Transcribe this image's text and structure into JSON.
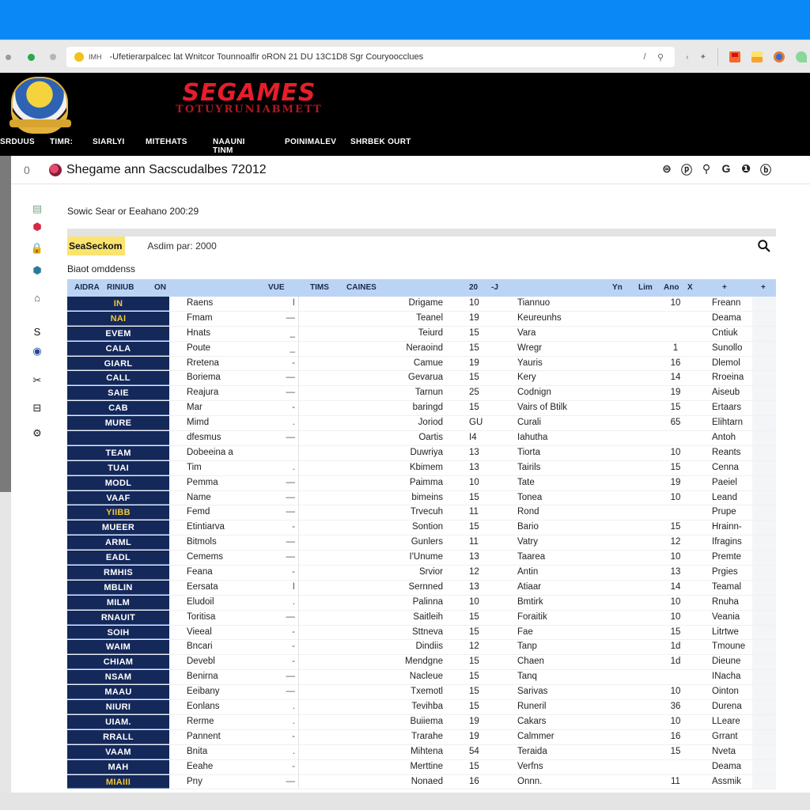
{
  "browser": {
    "tab_short": "IMH",
    "url": "-Ufetierarpalcec lat Wnitcor Tounnoalfir oRON 21 DU 13C1D8 Sgr Couryoocclues",
    "addr_icons": [
      "edit-icon",
      "bookmark-icon"
    ],
    "extensions": [
      "red-extension",
      "yellow-extension",
      "blue-extension",
      "green-extension"
    ]
  },
  "site": {
    "brand_title": "SEGAMES",
    "brand_subtitle": "TOTUYRUNIABMETT",
    "nav": [
      "SRDUUS",
      "TIMR:",
      "SIARLYI",
      "MITEHATS",
      "NAAUNI TINM",
      "POINIMALEV",
      "SHRBEK OURT"
    ]
  },
  "page": {
    "counter": "0",
    "title": "Shegame ann Sacscudalbes 72012",
    "top_icons": [
      "list-icon",
      "help-icon",
      "pin-icon",
      "g-icon",
      "user-icon",
      "badge-icon"
    ],
    "top_icon_glyphs": [
      "⊜",
      "ⓟ",
      "⚲",
      "G",
      "❶",
      "ⓑ"
    ],
    "season_line": "Sowic Sear or Eeahano 200:29",
    "tag": "SeaSeckom",
    "filter_text": "Asdim par: 2000",
    "section_title": "Biaot omddenss"
  },
  "sidebar": {
    "icons": [
      {
        "name": "doc-icon",
        "glyph": "▤",
        "color": "#7aa888"
      },
      {
        "name": "team-crest-red-icon",
        "glyph": "⬢",
        "color": "#d42a44"
      },
      {
        "name": "lock-badge-icon",
        "glyph": "🔒",
        "color": "#e7c21c"
      },
      {
        "name": "team-crest-blue-icon",
        "glyph": "⬢",
        "color": "#2a7a9a"
      },
      {
        "name": "home-icon",
        "glyph": "⌂",
        "color": "#444"
      },
      {
        "name": "s-icon",
        "glyph": "S",
        "color": "#111"
      },
      {
        "name": "bulb-icon",
        "glyph": "◉",
        "color": "#1f4a9a"
      },
      {
        "name": "tools-icon",
        "glyph": "✂",
        "color": "#222"
      },
      {
        "name": "printer-icon",
        "glyph": "⊟",
        "color": "#222"
      },
      {
        "name": "settings-icon",
        "glyph": "⚙",
        "color": "#222"
      }
    ]
  },
  "table": {
    "headers": [
      "AIDRA",
      "RINIUB",
      "ON",
      "VUE",
      "TIMS",
      "CAINES",
      "20",
      "-J",
      "Yn",
      "Lim",
      "Ano",
      "X",
      "+",
      "+"
    ],
    "rows": [
      {
        "code": "IN",
        "gold": true,
        "name": "Raens",
        "mark": "I",
        "team": "Drigame",
        "n1": "10",
        "opp": "Tiannuo",
        "n2": "10",
        "city": "Freann"
      },
      {
        "code": "NAI",
        "gold": true,
        "name": "Fmam",
        "mark": "—",
        "team": "Teanel",
        "n1": "19",
        "opp": "Keureunhs",
        "n2": "",
        "city": "Deama"
      },
      {
        "code": "EVEM",
        "gold": false,
        "name": "Hnats",
        "mark": "_",
        "team": "Teiurd",
        "n1": "15",
        "opp": "Vara",
        "n2": "",
        "city": "Cntiuk"
      },
      {
        "code": "CALA",
        "gold": false,
        "name": "Poute",
        "mark": "_",
        "team": "Neraoind",
        "n1": "15",
        "opp": "Wregr",
        "n2": "1",
        "city": "Sunollo"
      },
      {
        "code": "GIARL",
        "gold": false,
        "name": "Rretena",
        "mark": "-",
        "team": "Camue",
        "n1": "19",
        "opp": "Yauris",
        "n2": "16",
        "city": "Dlemol"
      },
      {
        "code": "CALL",
        "gold": false,
        "name": "Boriema",
        "mark": "—",
        "team": "Gevarua",
        "n1": "15",
        "opp": "Kery",
        "n2": "14",
        "city": "Rroeina"
      },
      {
        "code": "SAIE",
        "gold": false,
        "name": "Reajura",
        "mark": "—",
        "team": "Tarnun",
        "n1": "25",
        "opp": "Codnign",
        "n2": "19",
        "city": "Aiseub"
      },
      {
        "code": "CAB",
        "gold": false,
        "name": "Mar",
        "mark": "-",
        "team": "baringd",
        "n1": "15",
        "opp": "Vairs of Btilk",
        "n2": "15",
        "city": "Ertaars"
      },
      {
        "code": "MURE",
        "gold": false,
        "name": "Mimd",
        "mark": ".",
        "team": "Joriod",
        "n1": "GU",
        "opp": "Curali",
        "n2": "65",
        "city": "Elihtarn"
      },
      {
        "code": "",
        "gold": false,
        "name": "dfesmus",
        "mark": "—",
        "team": "Oartis",
        "n1": "I4",
        "opp": "Iahutha",
        "n2": "",
        "city": "Antoh"
      },
      {
        "code": "TEAM",
        "gold": false,
        "name": "Dobeeina a",
        "mark": "",
        "team": "Duwriya",
        "n1": "13",
        "opp": "Tiorta",
        "n2": "10",
        "city": "Reants"
      },
      {
        "code": "TUAI",
        "gold": false,
        "name": "Tim",
        "mark": ".",
        "team": "Kbimem",
        "n1": "13",
        "opp": "Tairils",
        "n2": "15",
        "city": "Cenna"
      },
      {
        "code": "MODL",
        "gold": false,
        "name": "Pemma",
        "mark": "—",
        "team": "Paimma",
        "n1": "10",
        "opp": "Tate",
        "n2": "19",
        "city": "Paeiel"
      },
      {
        "code": "VAAF",
        "gold": false,
        "name": "Name",
        "mark": "—",
        "team": "bimeins",
        "n1": "15",
        "opp": "Tonea",
        "n2": "10",
        "city": "Leand"
      },
      {
        "code": "YIIBB",
        "gold": true,
        "name": "Femd",
        "mark": "—",
        "team": "Trvecuh",
        "n1": "11",
        "opp": "Rond",
        "n2": "",
        "city": "Prupe"
      },
      {
        "code": "MUEER",
        "gold": false,
        "name": "Etintiarva",
        "mark": "-",
        "team": "Sontion",
        "n1": "15",
        "opp": "Bario",
        "n2": "15",
        "city": "Hrainn-"
      },
      {
        "code": "ARML",
        "gold": false,
        "name": "Bitmols",
        "mark": "—",
        "team": "Gunlers",
        "n1": "11",
        "opp": "Vatry",
        "n2": "12",
        "city": "Ifragins"
      },
      {
        "code": "EADL",
        "gold": false,
        "name": "Cemems",
        "mark": "—",
        "team": "I'Unume",
        "n1": "13",
        "opp": "Taarea",
        "n2": "10",
        "city": "Premte"
      },
      {
        "code": "RMHIS",
        "gold": false,
        "name": "Feana",
        "mark": "-",
        "team": "Srvior",
        "n1": "12",
        "opp": "Antin",
        "n2": "13",
        "city": "Prgies"
      },
      {
        "code": "MBLIN",
        "gold": false,
        "name": "Eersata",
        "mark": "I",
        "team": "Sernned",
        "n1": "13",
        "opp": "Atiaar",
        "n2": "14",
        "city": "Teamal"
      },
      {
        "code": "MILM",
        "gold": false,
        "name": "Eludoil",
        "mark": ".",
        "team": "Palinna",
        "n1": "10",
        "opp": "Bmtirk",
        "n2": "10",
        "city": "Rnuha"
      },
      {
        "code": "RNAUIT",
        "gold": false,
        "name": "Toritisa",
        "mark": "—",
        "team": "Saitleih",
        "n1": "15",
        "opp": "Foraitik",
        "n2": "10",
        "city": "Veania"
      },
      {
        "code": "SOIH",
        "gold": false,
        "name": "Vieeal",
        "mark": "-",
        "team": "Sttneva",
        "n1": "15",
        "opp": "Fae",
        "n2": "15",
        "city": "Litrtwe"
      },
      {
        "code": "WAIM",
        "gold": false,
        "name": "Bncari",
        "mark": "-",
        "team": "Dindiis",
        "n1": "12",
        "opp": "Tanp",
        "n2": "1d",
        "city": "Tmoune"
      },
      {
        "code": "CHIAM",
        "gold": false,
        "name": "Devebl",
        "mark": "-",
        "team": "Mendgne",
        "n1": "15",
        "opp": "Chaen",
        "n2": "1d",
        "city": "Dieune"
      },
      {
        "code": "NSAM",
        "gold": false,
        "name": "Benirna",
        "mark": "—",
        "team": "Nacleue",
        "n1": "15",
        "opp": "Tanq",
        "n2": "",
        "city": "INacha"
      },
      {
        "code": "MAAU",
        "gold": false,
        "name": "Eeibany",
        "mark": "—",
        "team": "Txemotl",
        "n1": "15",
        "opp": "Sarivas",
        "n2": "10",
        "city": "Ointon"
      },
      {
        "code": "NIURI",
        "gold": false,
        "name": "Eonlans",
        "mark": ".",
        "team": "Tevihba",
        "n1": "15",
        "opp": "Runeril",
        "n2": "36",
        "city": "Durena"
      },
      {
        "code": "UIAM.",
        "gold": false,
        "name": "Rerme",
        "mark": ".",
        "team": "Buiiema",
        "n1": "19",
        "opp": "Cakars",
        "n2": "10",
        "city": "LLeare"
      },
      {
        "code": "RRALL",
        "gold": false,
        "name": "Pannent",
        "mark": "-",
        "team": "Trarahe",
        "n1": "19",
        "opp": "Calmmer",
        "n2": "16",
        "city": "Grrant"
      },
      {
        "code": "VAAM",
        "gold": false,
        "name": "Bnita",
        "mark": ".",
        "team": "Mihtena",
        "n1": "54",
        "opp": "Teraida",
        "n2": "15",
        "city": "Nveta"
      },
      {
        "code": "MAH",
        "gold": false,
        "name": "Eeahe",
        "mark": "-",
        "team": "Merttine",
        "n1": "15",
        "opp": "Verfns",
        "n2": "",
        "city": "Deama"
      },
      {
        "code": "MIAIII",
        "gold": true,
        "name": "Pny",
        "mark": "—",
        "team": "Nonaed",
        "n1": "16",
        "opp": "Onnn.",
        "n2": "11",
        "city": "Assmik"
      }
    ]
  }
}
